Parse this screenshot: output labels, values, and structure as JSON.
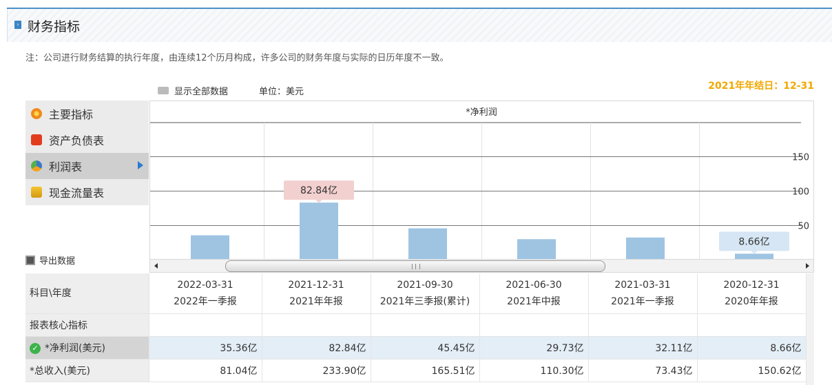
{
  "header": {
    "title": "财务指标",
    "square_icon": "collapse-icon"
  },
  "note": "注：公司进行财务结算的执行年度，由连续12个历月构成，许多公司的财务年度与实际的日历年度不一致。",
  "fiscal_year_end": "2021年年结日：12-31",
  "controls": {
    "show_all": "显示全部数据",
    "unit": "单位：美元"
  },
  "nav": {
    "items": [
      {
        "label": "主要指标",
        "icon": "flower-icon",
        "active": false
      },
      {
        "label": "资产负债表",
        "icon": "document-icon",
        "active": false
      },
      {
        "label": "利润表",
        "icon": "pie-icon",
        "active": true
      },
      {
        "label": "现金流量表",
        "icon": "coins-icon",
        "active": false
      }
    ]
  },
  "export_label": "导出数据",
  "chart_data": {
    "type": "bar",
    "title": "*净利润",
    "categories": [
      "2022-03-31",
      "2021-12-31",
      "2021-09-30",
      "2021-06-30",
      "2021-03-31",
      "2020-12-31"
    ],
    "values": [
      35.36,
      82.84,
      45.45,
      29.73,
      32.11,
      8.66
    ],
    "unit": "亿",
    "yticks": [
      50,
      100,
      150
    ],
    "tooltips": [
      {
        "index": 1,
        "label": "82.84亿",
        "color": "#f2d0cf"
      },
      {
        "index": 5,
        "label": "8.66亿",
        "color": "#d6e6f4"
      }
    ],
    "bar_color": "#9ec4e2",
    "grid": true
  },
  "table": {
    "corner": "科目\\年度",
    "columns": [
      {
        "date": "2022-03-31",
        "report": "2022年一季报"
      },
      {
        "date": "2021-12-31",
        "report": "2021年年报"
      },
      {
        "date": "2021-09-30",
        "report": "2021年三季报(累计)"
      },
      {
        "date": "2021-06-30",
        "report": "2021年中报"
      },
      {
        "date": "2021-03-31",
        "report": "2021年一季报"
      },
      {
        "date": "2020-12-31",
        "report": "2020年年报"
      }
    ],
    "section": "报表核心指标",
    "rows": [
      {
        "label": "*净利润(美元)",
        "values": [
          "35.36亿",
          "82.84亿",
          "45.45亿",
          "29.73亿",
          "32.11亿",
          "8.66亿"
        ]
      },
      {
        "label": "*总收入(美元)",
        "values": [
          "81.04亿",
          "233.90亿",
          "165.51亿",
          "110.30亿",
          "73.43亿",
          "150.62亿"
        ]
      }
    ]
  }
}
